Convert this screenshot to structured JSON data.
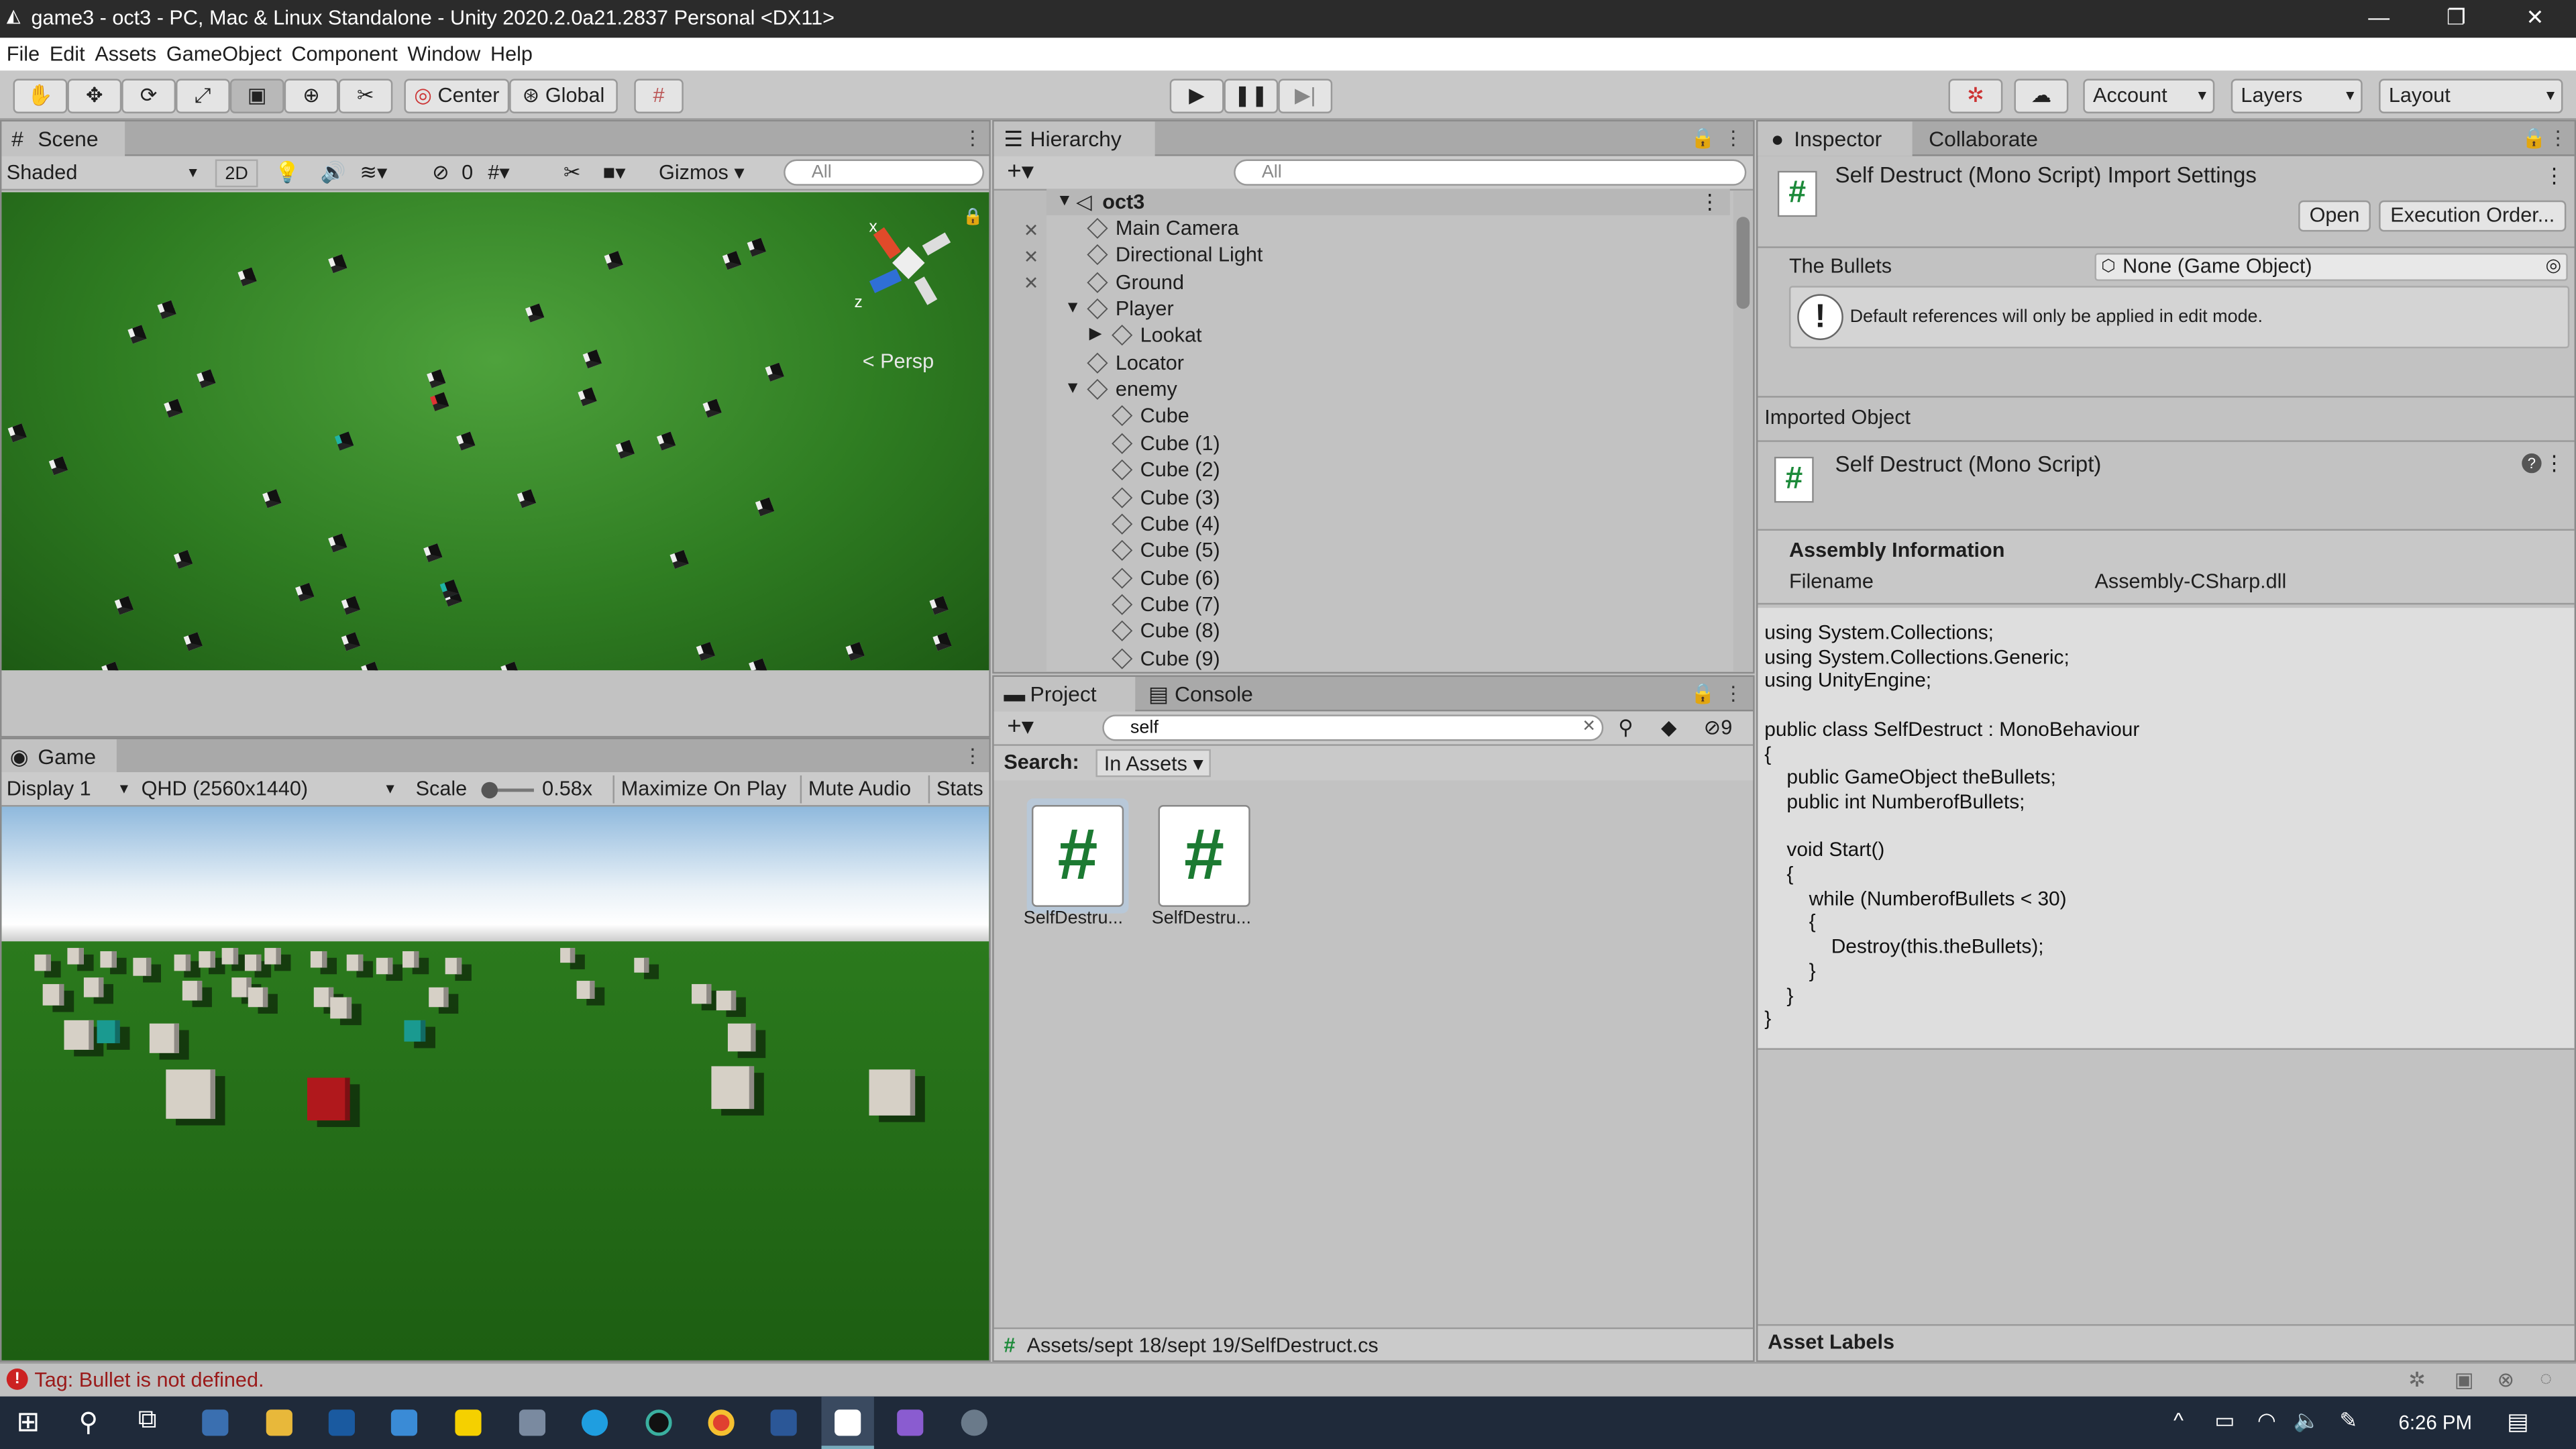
{
  "window": {
    "title": "game3 - oct3 - PC, Mac & Linux Standalone - Unity 2020.2.0a21.2837 Personal <DX11>",
    "minimize": "—",
    "restore": "❐",
    "close": "✕"
  },
  "menu": [
    "File",
    "Edit",
    "Assets",
    "GameObject",
    "Component",
    "Window",
    "Help"
  ],
  "toolbar": {
    "center": "Center",
    "global": "Global",
    "account": "Account",
    "layers": "Layers",
    "layout": "Layout"
  },
  "scene": {
    "tab": "Scene",
    "shading": "Shaded",
    "mode2d": "2D",
    "hidden_count": "0",
    "gizmos": "Gizmos",
    "search_placeholder": "All",
    "persp": "Persp",
    "axis_x": "x",
    "axis_z": "z"
  },
  "game": {
    "tab": "Game",
    "display": "Display 1",
    "resolution": "QHD (2560x1440)",
    "scale_label": "Scale",
    "scale_value": "0.58x",
    "maximize": "Maximize On Play",
    "mute": "Mute Audio",
    "stats": "Stats"
  },
  "hierarchy": {
    "tab": "Hierarchy",
    "search_placeholder": "All",
    "scene_name": "oct3",
    "items": [
      {
        "label": "Main Camera",
        "indent": 1
      },
      {
        "label": "Directional Light",
        "indent": 1
      },
      {
        "label": "Ground",
        "indent": 1
      },
      {
        "label": "Player",
        "indent": 1,
        "expanded": true
      },
      {
        "label": "Lookat",
        "indent": 2,
        "collapsed": true
      },
      {
        "label": "Locator",
        "indent": 1
      },
      {
        "label": "enemy",
        "indent": 1,
        "expanded": true
      },
      {
        "label": "Cube",
        "indent": 2
      },
      {
        "label": "Cube (1)",
        "indent": 2
      },
      {
        "label": "Cube (2)",
        "indent": 2
      },
      {
        "label": "Cube (3)",
        "indent": 2
      },
      {
        "label": "Cube (4)",
        "indent": 2
      },
      {
        "label": "Cube (5)",
        "indent": 2
      },
      {
        "label": "Cube (6)",
        "indent": 2
      },
      {
        "label": "Cube (7)",
        "indent": 2
      },
      {
        "label": "Cube (8)",
        "indent": 2
      },
      {
        "label": "Cube (9)",
        "indent": 2
      }
    ]
  },
  "project": {
    "tab": "Project",
    "console_tab": "Console",
    "search_value": "self",
    "search_label": "Search:",
    "search_scope": "In Assets",
    "hidden_count": "9",
    "files": [
      {
        "name": "SelfDestru..."
      },
      {
        "name": "SelfDestru..."
      }
    ],
    "path": "Assets/sept 18/sept 19/SelfDestruct.cs"
  },
  "inspector": {
    "tab": "Inspector",
    "collab_tab": "Collaborate",
    "title": "Self Destruct (Mono Script) Import Settings",
    "open": "Open",
    "exec_order": "Execution Order...",
    "field_label": "The Bullets",
    "field_value": "None (Game Object)",
    "info": "Default references will only be applied in edit mode.",
    "imported_object": "Imported Object",
    "script_title": "Self Destruct (Mono Script)",
    "assembly_header": "Assembly Information",
    "filename_label": "Filename",
    "filename_value": "Assembly-CSharp.dll",
    "code": "using System.Collections;\nusing System.Collections.Generic;\nusing UnityEngine;\n\npublic class SelfDestruct : MonoBehaviour\n{\n    public GameObject theBullets;\n    public int NumberofBullets;\n\n    void Start()\n    {\n        while (NumberofBullets < 30)\n        {\n            Destroy(this.theBullets);\n        }\n    }\n}",
    "asset_labels": "Asset Labels"
  },
  "status": {
    "message": "Tag: Bullet is not defined."
  },
  "taskbar": {
    "time": "6:26 PM"
  },
  "colors": {
    "error": "#cc2222",
    "accent_green": "#1c8a3a"
  }
}
